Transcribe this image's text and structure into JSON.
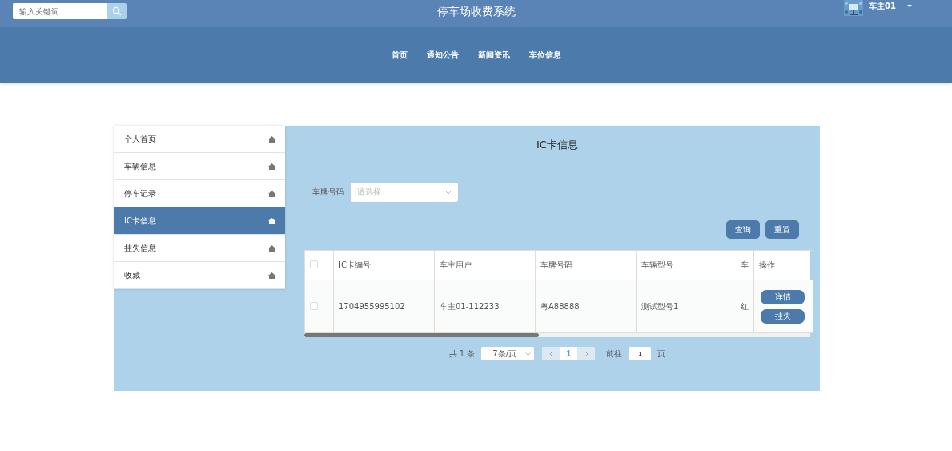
{
  "header": {
    "search": {
      "placeholder": "输入关键词"
    },
    "title": "停车场收费系统",
    "user": {
      "name": "车主01"
    }
  },
  "nav": [
    {
      "label": "首页"
    },
    {
      "label": "通知公告"
    },
    {
      "label": "新闻资讯"
    },
    {
      "label": "车位信息"
    }
  ],
  "sidebar": {
    "items": [
      {
        "label": "个人首页",
        "selected": false
      },
      {
        "label": "车辆信息",
        "selected": false
      },
      {
        "label": "停车记录",
        "selected": false
      },
      {
        "label": "IC卡信息",
        "selected": true
      },
      {
        "label": "挂失信息",
        "selected": false
      },
      {
        "label": "收藏",
        "selected": false
      }
    ]
  },
  "page_title": "IC卡信息",
  "filter": {
    "label": "车牌号码",
    "placeholder": "请选择"
  },
  "actions": [
    "查询",
    "重置"
  ],
  "table": {
    "columns": [
      "IC卡编号",
      "车主用户",
      "车牌号码",
      "车辆型号",
      "车"
    ],
    "ops_column": "操作",
    "rows": [
      {
        "checked": false,
        "cells": [
          "1704955995102",
          "车主01-112233",
          "粤A88888",
          "测试型号1",
          "红"
        ],
        "buttons": [
          "详情",
          "挂失"
        ]
      }
    ]
  },
  "header_checked": false,
  "pagination": {
    "total": "共 1 条",
    "page_size": "7条/页",
    "pages": [
      {
        "label": "1",
        "selected": true
      }
    ],
    "goto_label": "前往",
    "goto_value": "1",
    "goto_suffix": "页"
  }
}
